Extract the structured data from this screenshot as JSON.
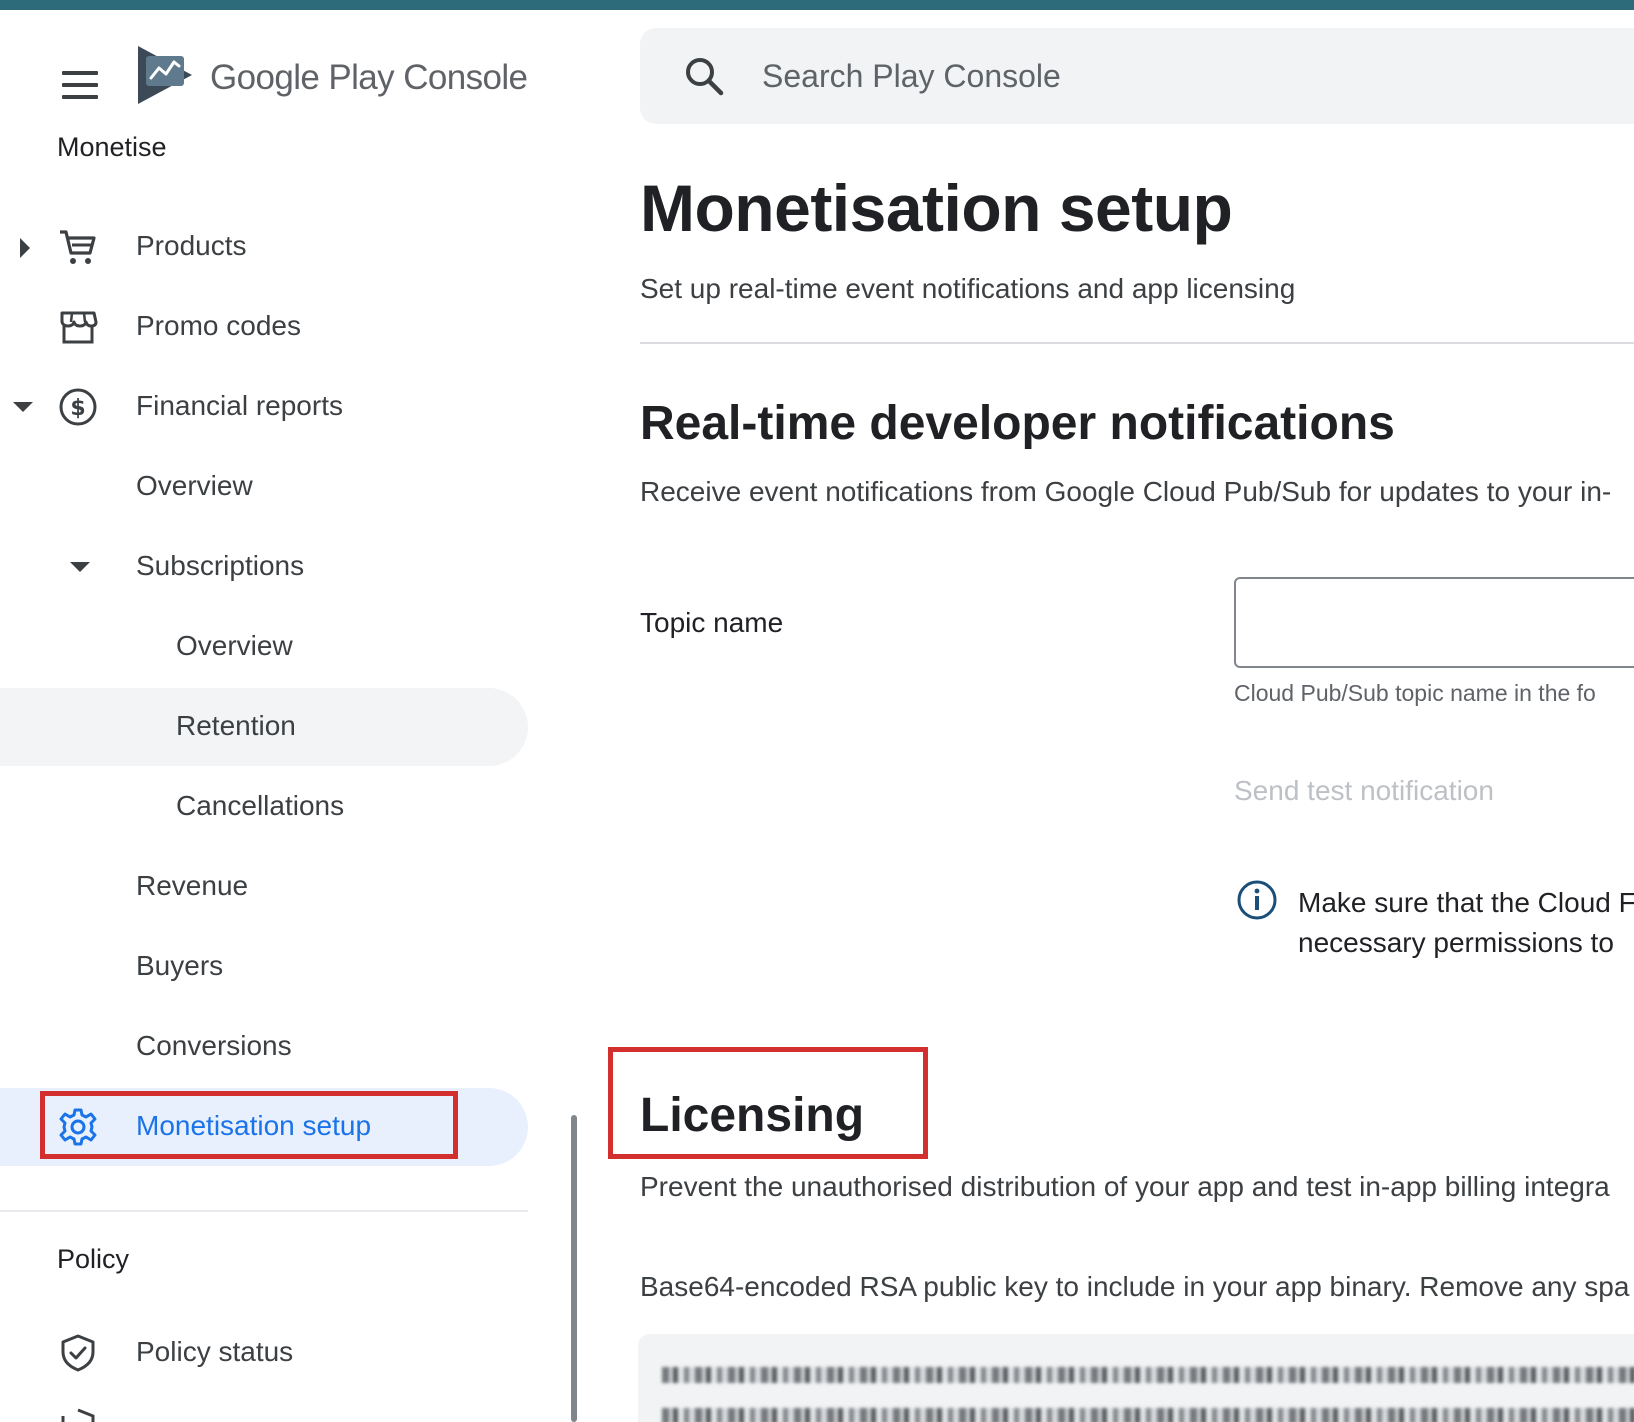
{
  "app": {
    "brand_google_play": "Google Play",
    "brand_console": "Console"
  },
  "search": {
    "placeholder": "Search Play Console"
  },
  "sidebar": {
    "section_monetise": "Monetise",
    "products": "Products",
    "promo_codes": "Promo codes",
    "financial_reports": "Financial reports",
    "fr_overview": "Overview",
    "subscriptions": "Subscriptions",
    "sub_overview": "Overview",
    "retention": "Retention",
    "cancellations": "Cancellations",
    "revenue": "Revenue",
    "buyers": "Buyers",
    "conversions": "Conversions",
    "monetisation_setup": "Monetisation setup",
    "section_policy": "Policy",
    "policy_status": "Policy status"
  },
  "main": {
    "title": "Monetisation setup",
    "subtitle": "Set up real-time event notifications and app licensing",
    "rtdn_heading": "Real-time developer notifications",
    "rtdn_desc": "Receive event notifications from Google Cloud Pub/Sub for updates to your in-",
    "topic_label": "Topic name",
    "topic_value": "",
    "topic_helper": "Cloud Pub/Sub topic name in the fo",
    "send_test": "Send test notification",
    "info_line1": "Make sure that the Cloud F",
    "info_line2": "necessary permissions to",
    "licensing_heading": "Licensing",
    "licensing_desc": "Prevent the unauthorised distribution of your app and test in-app billing integra",
    "key_desc": "Base64-encoded RSA public key to include in your app binary. Remove any spa"
  },
  "colors": {
    "accent": "#1a73e8",
    "highlight_border": "#d32f2f",
    "top_bar": "#2e6b7a",
    "info_icon": "#1a4f7a"
  },
  "icons": {
    "menu": "menu-icon",
    "logo": "play-console-logo-icon",
    "search": "search-icon",
    "products": "cart-icon",
    "promo_codes": "storefront-icon",
    "financial_reports": "dollar-circle-icon",
    "monetisation_setup": "gear-icon",
    "policy_status": "shield-check-icon",
    "info": "info-icon"
  }
}
